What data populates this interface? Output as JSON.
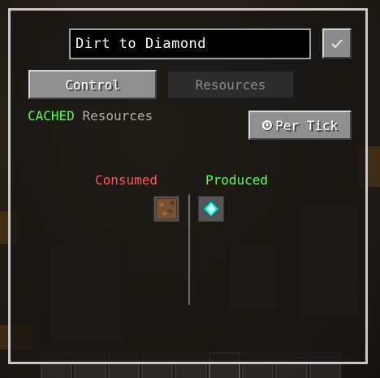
{
  "panel": {
    "name_field_value": "Dirt to Diamond",
    "confirm_icon": "checkmark-icon",
    "tabs": [
      {
        "label": "Control",
        "active": true
      },
      {
        "label": "Resources",
        "active": false
      }
    ],
    "cache_status": "CACHED",
    "cache_label": "Resources",
    "rate_button": {
      "icon": "clock-icon",
      "label": "Per Tick"
    },
    "consumed": {
      "label": "Consumed",
      "color": "#ff5555",
      "items": [
        {
          "icon": "dirt-block-icon"
        }
      ]
    },
    "produced": {
      "label": "Produced",
      "color": "#55ff55",
      "items": [
        {
          "icon": "diamond-icon"
        }
      ]
    }
  },
  "colors": {
    "status_green": "#55ff55",
    "status_red": "#ff5555",
    "button_gray": "#8f8f8f",
    "panel_border": "#c8c8c8"
  }
}
